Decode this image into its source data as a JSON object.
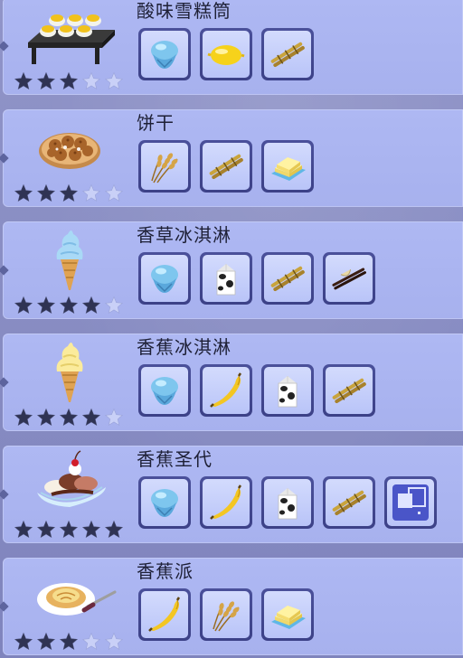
{
  "recipes": [
    {
      "name": "酸味雪糕筒",
      "dish_icon": "lemon-custard-tray-icon",
      "rating": 3,
      "max_rating": 5,
      "ingredients": [
        "ice-icon",
        "lemon-icon",
        "sugarcane-icon"
      ]
    },
    {
      "name": "饼干",
      "dish_icon": "cookies-plate-icon",
      "rating": 3,
      "max_rating": 5,
      "ingredients": [
        "wheat-icon",
        "sugarcane-icon",
        "butter-icon"
      ]
    },
    {
      "name": "香草冰淇淋",
      "dish_icon": "vanilla-ice-cream-cone-icon",
      "rating": 4,
      "max_rating": 5,
      "ingredients": [
        "ice-icon",
        "milk-carton-icon",
        "sugarcane-icon",
        "vanilla-icon"
      ]
    },
    {
      "name": "香蕉冰淇淋",
      "dish_icon": "banana-ice-cream-cone-icon",
      "rating": 4,
      "max_rating": 5,
      "ingredients": [
        "ice-icon",
        "banana-icon",
        "milk-carton-icon",
        "sugarcane-icon"
      ]
    },
    {
      "name": "香蕉圣代",
      "dish_icon": "banana-split-icon",
      "rating": 5,
      "max_rating": 5,
      "ingredients": [
        "ice-icon",
        "banana-icon",
        "milk-carton-icon",
        "sugarcane-icon",
        "any-ingredient-icon"
      ]
    },
    {
      "name": "香蕉派",
      "dish_icon": "banana-pie-icon",
      "rating": 3,
      "max_rating": 5,
      "ingredients": [
        "banana-icon",
        "wheat-icon",
        "butter-icon"
      ]
    }
  ],
  "colors": {
    "row_bg": "#aeb8f3",
    "slot_border": "#4a509a",
    "star_filled": "#2f3353",
    "star_empty": "#c9d0f7",
    "text": "#1e2036"
  }
}
